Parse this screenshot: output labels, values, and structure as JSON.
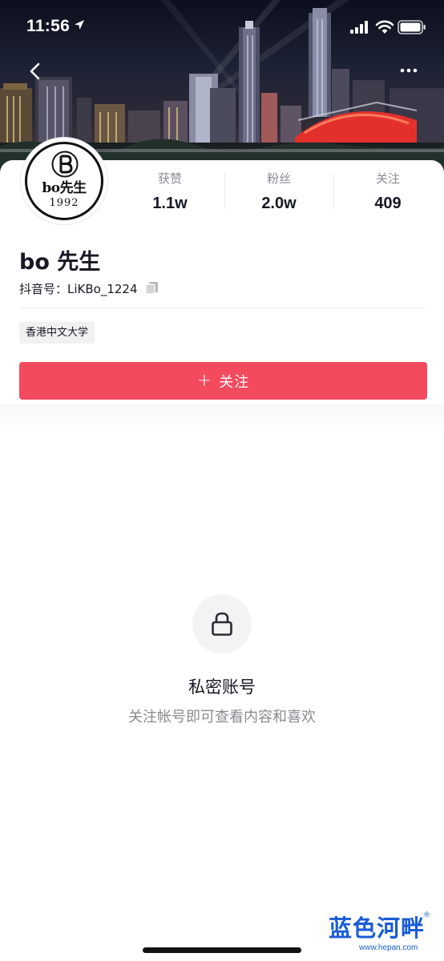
{
  "status_bar": {
    "time": "11:56"
  },
  "icons": {
    "back": "chevron-left-icon",
    "more": "more-horizontal-icon",
    "copy": "copy-icon",
    "lock": "lock-icon",
    "location": "location-arrow-icon",
    "signal": "cellular-signal-icon",
    "wifi": "wifi-icon",
    "battery": "battery-icon"
  },
  "profile": {
    "avatar_text": "bo先生",
    "avatar_year": "1992",
    "nickname": "bo 先生",
    "douyin_id": "抖音号：LiKBo_1224",
    "school": "香港中文大学"
  },
  "stats": [
    {
      "label": "获赞",
      "value": "1.1w"
    },
    {
      "label": "粉丝",
      "value": "2.0w"
    },
    {
      "label": "关注",
      "value": "409"
    }
  ],
  "follow_button": {
    "plus": "+",
    "label": "关注"
  },
  "private": {
    "title": "私密账号",
    "subtitle": "关注帐号即可查看内容和喜欢"
  },
  "watermark": {
    "text": "蓝色河畔",
    "url": "www.hepan.com",
    "mark": "®"
  },
  "colors": {
    "follow_button": "#f34a5e",
    "primary_text": "#161823",
    "secondary_text": "#8a8b91",
    "watermark": "#1a5cd6"
  }
}
